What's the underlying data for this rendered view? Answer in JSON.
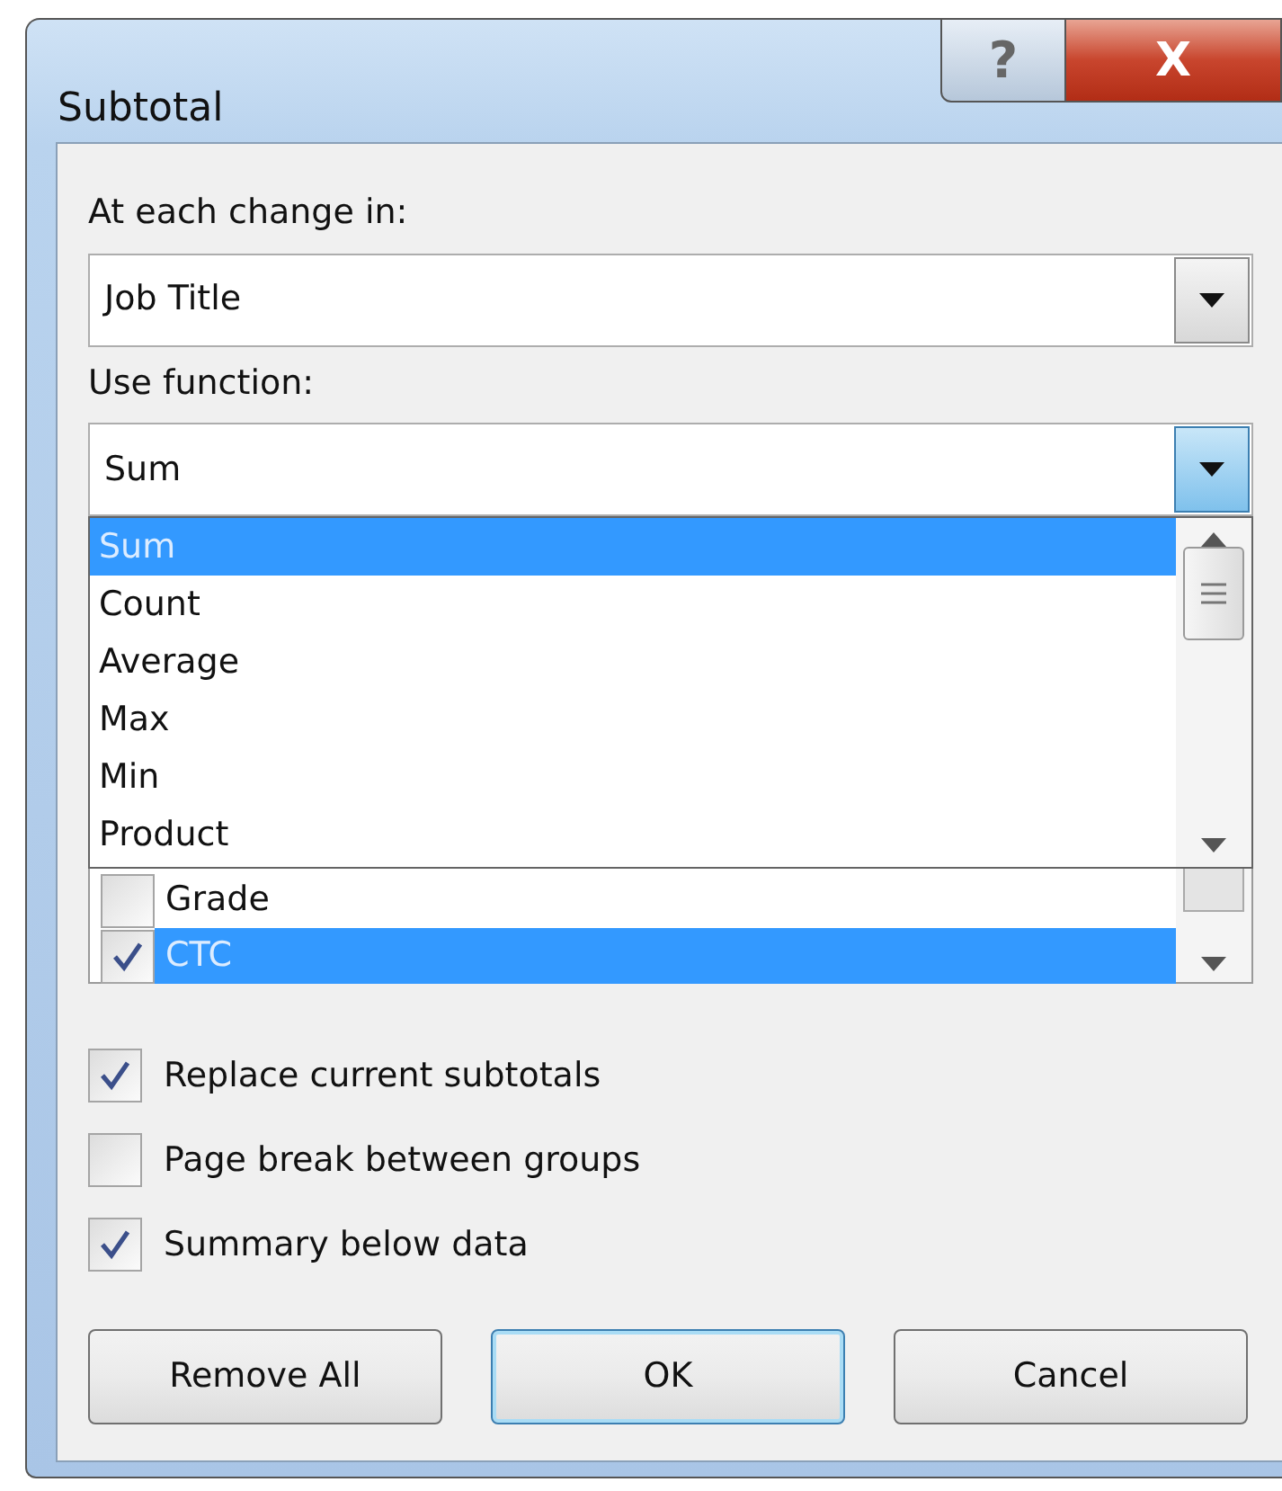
{
  "window": {
    "title": "Subtotal",
    "help_button": "?",
    "close_button": "X"
  },
  "change_field": {
    "label": "At each change in:",
    "value": "Job Title"
  },
  "function_field": {
    "label": "Use function:",
    "value": "Sum",
    "expanded": true
  },
  "function_options": [
    {
      "label": "Sum",
      "selected": true
    },
    {
      "label": "Count",
      "selected": false
    },
    {
      "label": "Average",
      "selected": false
    },
    {
      "label": "Max",
      "selected": false
    },
    {
      "label": "Min",
      "selected": false
    },
    {
      "label": "Product",
      "selected": false
    }
  ],
  "subtotal_fields": [
    {
      "label": "Grade",
      "checked": false,
      "selected": false
    },
    {
      "label": "CTC",
      "checked": true,
      "selected": true
    }
  ],
  "options": [
    {
      "label": "Replace current subtotals",
      "checked": true
    },
    {
      "label": "Page break between groups",
      "checked": false
    },
    {
      "label": "Summary below data",
      "checked": true
    }
  ],
  "buttons": [
    {
      "label": "Remove All",
      "default": false
    },
    {
      "label": "OK",
      "default": true
    },
    {
      "label": "Cancel",
      "default": false
    }
  ]
}
